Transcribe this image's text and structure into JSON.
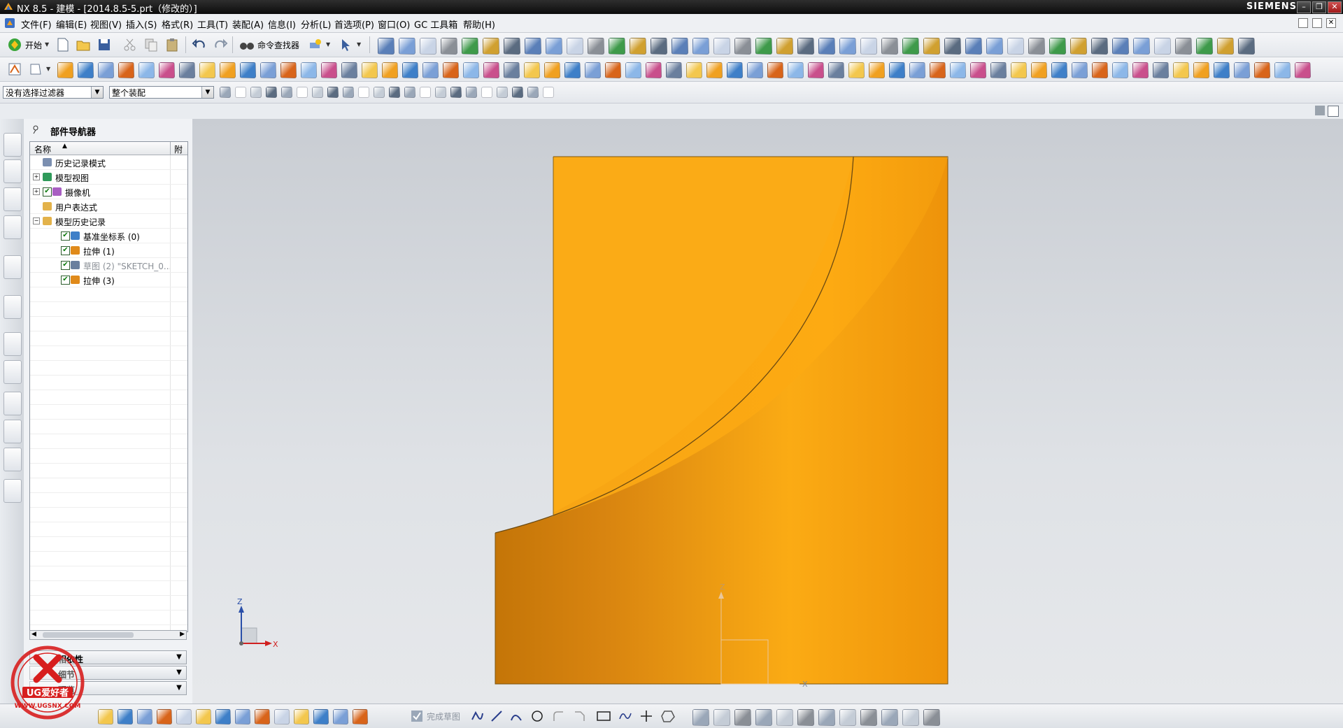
{
  "window": {
    "title": "NX 8.5 - 建模 - [2014.8.5-5.prt（修改的）]",
    "brand": "SIEMENS",
    "controls": [
      "–",
      "❐",
      "✕"
    ]
  },
  "menubar": {
    "items": [
      "文件(F)",
      "编辑(E)",
      "视图(V)",
      "插入(S)",
      "格式(R)",
      "工具(T)",
      "装配(A)",
      "信息(I)",
      "分析(L)",
      "首选项(P)",
      "窗口(O)",
      "GC 工具箱",
      "帮助(H)"
    ]
  },
  "toolbar1": {
    "start_label": "开始",
    "command_finder_label": "命令查找器"
  },
  "selection_bar": {
    "filter_value": "没有选择过滤器",
    "scope_value": "整个装配"
  },
  "navigator": {
    "title": "部件导航器",
    "col_name": "名称",
    "col_attach": "附",
    "nodes": [
      {
        "label": "历史记录模式",
        "indent": 0,
        "expander": "",
        "check": false
      },
      {
        "label": "模型视图",
        "indent": 0,
        "expander": "+",
        "check": false
      },
      {
        "label": "摄像机",
        "indent": 0,
        "expander": "+",
        "check": true
      },
      {
        "label": "用户表达式",
        "indent": 0,
        "expander": "",
        "check": false
      },
      {
        "label": "模型历史记录",
        "indent": 0,
        "expander": "−",
        "check": false
      },
      {
        "label": "基准坐标系 (0)",
        "indent": 1,
        "expander": "",
        "check": true
      },
      {
        "label": "拉伸 (1)",
        "indent": 1,
        "expander": "",
        "check": true
      },
      {
        "label": "草图 (2) \"SKETCH_0...",
        "indent": 1,
        "expander": "",
        "check": true,
        "dim": true
      },
      {
        "label": "拉伸 (3)",
        "indent": 1,
        "expander": "",
        "check": true
      }
    ],
    "panels": [
      "相依性",
      "细节",
      "预览"
    ]
  },
  "bottombar": {
    "finish_sketch_label": "完成草图"
  },
  "axes": {
    "z": "Z",
    "x": "X"
  },
  "watermark": {
    "text": "UG爱好者",
    "url": "WWW.UGSNX.COM"
  },
  "colors": {
    "part_orange": "#f7a014",
    "part_dark": "#c67a08",
    "title_bg": "#1b1b1b"
  }
}
